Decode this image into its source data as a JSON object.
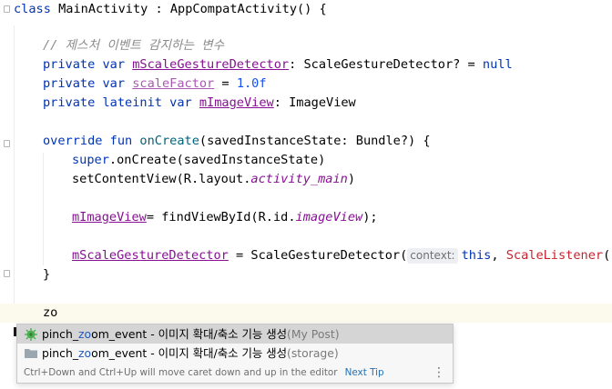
{
  "editor": {
    "class_line": {
      "kw": "class",
      "rest": " MainActivity : AppCompatActivity() {"
    },
    "comment": "// 제스처 이벤트 감지하는 변수",
    "var1": {
      "kw": "private var ",
      "name": "mScaleGestureDetector",
      "rest": ": ScaleGestureDetector? = ",
      "null": "null"
    },
    "var2": {
      "kw": "private var ",
      "name": "scaleFactor",
      "eq": " = ",
      "val": "1.0f"
    },
    "var3": {
      "kw": "private lateinit var ",
      "name": "mImageView",
      "rest": ": ImageView"
    },
    "oncreate": {
      "kw": "override fun ",
      "name": "onCreate",
      "rest": "(savedInstanceState: Bundle?) {"
    },
    "super_line": {
      "kw": "super",
      "rest": ".onCreate(savedInstanceState)"
    },
    "setcontent": {
      "pre": "setContentView(R.layout.",
      "it": "activity_main",
      "post": ")"
    },
    "findview": {
      "name": "mImageView",
      "pre": "= findViewById(R.id.",
      "it": "imageView",
      "post": ");"
    },
    "scaledet": {
      "name": "mScaleGestureDetector",
      "pre": " = ScaleGestureDetector(",
      "hint": "context:",
      "this": "this",
      "comma": ", ",
      "listener": "ScaleListener",
      "post": "())"
    },
    "close_brace": "}",
    "typed": "zo"
  },
  "popup": {
    "items": [
      {
        "pre": "pinch_",
        "match": "zo",
        "post": "om_event - 이미지 확대/축소 기능 생성",
        "source": "(My Post)",
        "icon": "bug-plugin-icon"
      },
      {
        "pre": "pinch_",
        "match": "zo",
        "post": "om_event - 이미지 확대/축소 기능 생성",
        "source": "(storage)",
        "icon": "folder-icon"
      }
    ],
    "tip": "Ctrl+Down and Ctrl+Up will move caret down and up in the editor",
    "next_tip": "Next Tip",
    "more_icon": "⋮"
  },
  "colors": {
    "keyword": "#0033b3",
    "property": "#871094",
    "comment": "#8c8c8c",
    "number": "#1750eb",
    "error": "#c7222d",
    "link": "#2470b3"
  }
}
